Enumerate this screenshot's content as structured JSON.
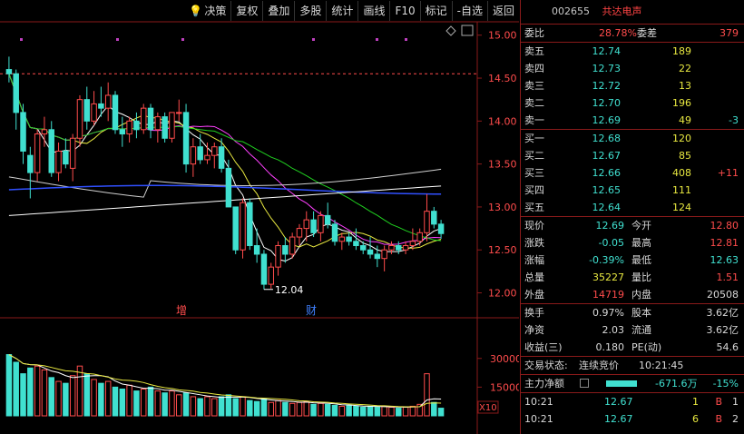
{
  "toolbar": {
    "items": [
      "决策",
      "复权",
      "叠加",
      "多股",
      "统计",
      "画线",
      "F10",
      "标记",
      "-自选",
      "返回"
    ]
  },
  "stock": {
    "code": "002655",
    "name": "共达电声"
  },
  "colors": {
    "up": "#ff4c4c",
    "down": "#40e0d0",
    "ma5": "#ffffff",
    "ma10": "#e8e840",
    "ma20": "#ff40ff",
    "ma60": "#20d020",
    "ma120": "#d0d0d0",
    "ma250": "#3050ff",
    "grid": "#8a1a1a"
  },
  "chart_data": {
    "type": "candlestick",
    "price_axis": {
      "ticks": [
        "15.00",
        "14.50",
        "14.00",
        "13.50",
        "13.00",
        "12.50",
        "12.00"
      ],
      "min": 11.9,
      "max": 15.05
    },
    "low_label": "12.04",
    "events": [
      "增",
      "财"
    ],
    "volume_axis": {
      "ticks": [
        "30000",
        "15000"
      ],
      "unit_label": "X10",
      "max": 37000
    },
    "candles": [
      [
        14.6,
        14.75,
        14.45,
        14.55
      ],
      [
        14.55,
        14.6,
        13.9,
        14.1
      ],
      [
        14.1,
        14.2,
        13.5,
        13.65
      ],
      [
        13.6,
        13.7,
        13.1,
        13.4
      ],
      [
        13.4,
        13.9,
        13.3,
        13.85
      ],
      [
        13.85,
        14.05,
        13.7,
        13.9
      ],
      [
        13.9,
        14.0,
        13.35,
        13.4
      ],
      [
        13.4,
        13.75,
        13.3,
        13.65
      ],
      [
        13.65,
        13.8,
        13.45,
        13.5
      ],
      [
        13.45,
        13.85,
        13.3,
        13.8
      ],
      [
        13.8,
        14.3,
        13.7,
        14.25
      ],
      [
        14.25,
        14.4,
        13.9,
        14.0
      ],
      [
        14.0,
        14.35,
        13.95,
        14.2
      ],
      [
        14.2,
        14.4,
        14.05,
        14.15
      ],
      [
        14.15,
        14.45,
        14.0,
        14.3
      ],
      [
        14.3,
        14.35,
        13.85,
        13.9
      ],
      [
        13.9,
        14.05,
        13.7,
        13.85
      ],
      [
        13.85,
        14.05,
        13.75,
        14.0
      ],
      [
        14.0,
        14.1,
        13.8,
        13.9
      ],
      [
        13.9,
        14.2,
        13.85,
        14.15
      ],
      [
        14.15,
        14.2,
        13.8,
        13.9
      ],
      [
        13.9,
        14.1,
        13.75,
        14.05
      ],
      [
        14.05,
        14.1,
        13.75,
        13.8
      ],
      [
        13.8,
        14.1,
        13.75,
        14.1
      ],
      [
        14.1,
        14.25,
        14.0,
        14.1
      ],
      [
        14.1,
        14.2,
        13.4,
        13.5
      ],
      [
        13.5,
        13.8,
        13.35,
        13.7
      ],
      [
        13.7,
        13.85,
        13.5,
        13.55
      ],
      [
        13.55,
        13.75,
        13.5,
        13.6
      ],
      [
        13.6,
        13.75,
        13.45,
        13.7
      ],
      [
        13.7,
        13.8,
        13.4,
        13.45
      ],
      [
        13.45,
        13.55,
        13.0,
        13.0
      ],
      [
        13.0,
        13.0,
        12.45,
        12.5
      ],
      [
        12.5,
        13.1,
        12.4,
        13.05
      ],
      [
        13.05,
        13.1,
        12.5,
        12.55
      ],
      [
        12.55,
        12.75,
        12.35,
        12.45
      ],
      [
        12.45,
        12.5,
        12.04,
        12.1
      ],
      [
        12.1,
        12.35,
        12.05,
        12.3
      ],
      [
        12.3,
        12.6,
        12.2,
        12.55
      ],
      [
        12.55,
        12.65,
        12.35,
        12.45
      ],
      [
        12.45,
        12.7,
        12.4,
        12.65
      ],
      [
        12.65,
        12.8,
        12.55,
        12.75
      ],
      [
        12.75,
        12.95,
        12.6,
        12.85
      ],
      [
        12.85,
        12.95,
        12.65,
        12.7
      ],
      [
        12.7,
        12.95,
        12.6,
        12.9
      ],
      [
        12.9,
        13.05,
        12.75,
        12.8
      ],
      [
        12.8,
        12.85,
        12.55,
        12.6
      ],
      [
        12.6,
        12.7,
        12.5,
        12.65
      ],
      [
        12.65,
        12.7,
        12.55,
        12.6
      ],
      [
        12.6,
        12.75,
        12.5,
        12.55
      ],
      [
        12.55,
        12.6,
        12.45,
        12.5
      ],
      [
        12.5,
        12.65,
        12.4,
        12.45
      ],
      [
        12.45,
        12.55,
        12.3,
        12.4
      ],
      [
        12.4,
        12.55,
        12.25,
        12.5
      ],
      [
        12.5,
        12.6,
        12.45,
        12.55
      ],
      [
        12.55,
        12.6,
        12.45,
        12.5
      ],
      [
        12.5,
        12.6,
        12.45,
        12.55
      ],
      [
        12.55,
        12.75,
        12.5,
        12.6
      ],
      [
        12.6,
        12.75,
        12.55,
        12.7
      ],
      [
        12.7,
        13.15,
        12.6,
        12.95
      ],
      [
        12.95,
        13.0,
        12.75,
        12.8
      ],
      [
        12.8,
        12.85,
        12.63,
        12.69
      ]
    ],
    "volumes": [
      32000,
      28000,
      22000,
      25000,
      26000,
      24000,
      20000,
      18000,
      17000,
      21000,
      26000,
      22000,
      19000,
      17000,
      18000,
      15000,
      14000,
      16000,
      13000,
      14000,
      15000,
      13000,
      12000,
      13000,
      11000,
      12000,
      10000,
      9000,
      10000,
      9000,
      10000,
      11000,
      9000,
      10000,
      8000,
      7500,
      9000,
      7000,
      8000,
      7000,
      6500,
      7000,
      7500,
      6000,
      6500,
      6000,
      5500,
      5000,
      5500,
      5000,
      4500,
      5000,
      4500,
      5000,
      4500,
      4000,
      4500,
      5000,
      6000,
      22000,
      7000,
      4000
    ]
  },
  "quote": {
    "weibi": {
      "label": "委比",
      "value": "28.78%",
      "label2": "委差",
      "value2": "379"
    },
    "sell": [
      {
        "label": "卖五",
        "price": "12.74",
        "vol": "189",
        "diff": ""
      },
      {
        "label": "卖四",
        "price": "12.73",
        "vol": "22",
        "diff": ""
      },
      {
        "label": "卖三",
        "price": "12.72",
        "vol": "13",
        "diff": ""
      },
      {
        "label": "卖二",
        "price": "12.70",
        "vol": "196",
        "diff": ""
      },
      {
        "label": "卖一",
        "price": "12.69",
        "vol": "49",
        "diff": "-3"
      }
    ],
    "buy": [
      {
        "label": "买一",
        "price": "12.68",
        "vol": "120",
        "diff": ""
      },
      {
        "label": "买二",
        "price": "12.67",
        "vol": "85",
        "diff": ""
      },
      {
        "label": "买三",
        "price": "12.66",
        "vol": "408",
        "diff": "+11"
      },
      {
        "label": "买四",
        "price": "12.65",
        "vol": "111",
        "diff": ""
      },
      {
        "label": "买五",
        "price": "12.64",
        "vol": "124",
        "diff": ""
      }
    ],
    "stats": [
      {
        "l1": "现价",
        "v1": "12.69",
        "l2": "今开",
        "v2": "12.80"
      },
      {
        "l1": "涨跌",
        "v1": "-0.05",
        "l2": "最高",
        "v2": "12.81"
      },
      {
        "l1": "涨幅",
        "v1": "-0.39%",
        "l2": "最低",
        "v2": "12.63"
      },
      {
        "l1": "总量",
        "v1": "35227",
        "l2": "量比",
        "v2": "1.51"
      },
      {
        "l1": "外盘",
        "v1": "14719",
        "l2": "内盘",
        "v2": "20508"
      }
    ],
    "finance": [
      {
        "l1": "换手",
        "v1": "0.97%",
        "l2": "股本",
        "v2": "3.62亿"
      },
      {
        "l1": "净资",
        "v1": "2.03",
        "l2": "流通",
        "v2": "3.62亿"
      },
      {
        "l1": "收益(三)",
        "v1": "0.180",
        "l2": "PE(动)",
        "v2": "54.6"
      }
    ],
    "trade_status": {
      "label": "交易状态:",
      "value": "连续竞价",
      "time": "10:21:45"
    },
    "main_flow": {
      "label": "主力净额",
      "value": "-671.6万",
      "pct": "-15%"
    },
    "ticks": [
      {
        "time": "10:21",
        "price": "12.67",
        "vol": "1",
        "side": "B",
        "count": "1"
      },
      {
        "time": "10:21",
        "price": "12.67",
        "vol": "6",
        "side": "B",
        "count": "2"
      }
    ]
  }
}
